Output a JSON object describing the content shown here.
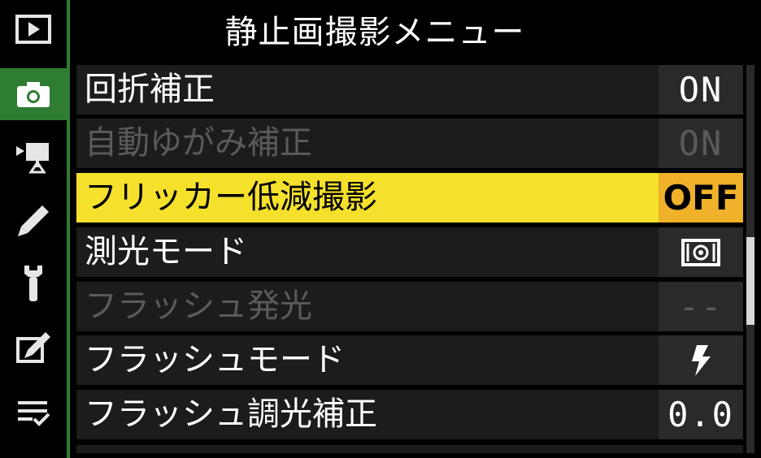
{
  "header": {
    "title": "静止画撮影メニュー"
  },
  "sidebar": {
    "tabs": [
      {
        "name": "playback-menu-tab",
        "icon": "play-icon",
        "active": false
      },
      {
        "name": "photo-shooting-menu-tab",
        "icon": "camera-icon",
        "active": true
      },
      {
        "name": "movie-shooting-menu-tab",
        "icon": "movie-camera-icon",
        "active": false
      },
      {
        "name": "custom-settings-menu-tab",
        "icon": "pencil-icon",
        "active": false
      },
      {
        "name": "setup-menu-tab",
        "icon": "wrench-icon",
        "active": false
      },
      {
        "name": "retouch-menu-tab",
        "icon": "retouch-brush-icon",
        "active": false
      },
      {
        "name": "my-menu-tab",
        "icon": "list-check-icon",
        "active": false
      }
    ]
  },
  "menu": {
    "items": [
      {
        "label": "回折補正",
        "value": "ON",
        "state": "normal"
      },
      {
        "label": "自動ゆがみ補正",
        "value": "ON",
        "state": "disabled"
      },
      {
        "label": "フリッカー低減撮影",
        "value": "OFF",
        "state": "selected"
      },
      {
        "label": "測光モード",
        "value": "",
        "value_icon": "matrix-metering-icon",
        "state": "normal"
      },
      {
        "label": "フラッシュ発光",
        "value": "--",
        "state": "disabled"
      },
      {
        "label": "フラッシュモード",
        "value": "",
        "value_icon": "flash-icon",
        "state": "normal"
      },
      {
        "label": "フラッシュ調光補正",
        "value": "0.0",
        "state": "normal"
      }
    ]
  },
  "colors": {
    "accent_green": "#2f7d32",
    "selected_row": "#f5e02c",
    "selected_value": "#f0b22a",
    "row_bg": "#1c1c1c",
    "value_bg": "#2a2a2a",
    "disabled_text": "#5a5a5a"
  },
  "scrollbar": {
    "position_fraction": 0.44
  }
}
